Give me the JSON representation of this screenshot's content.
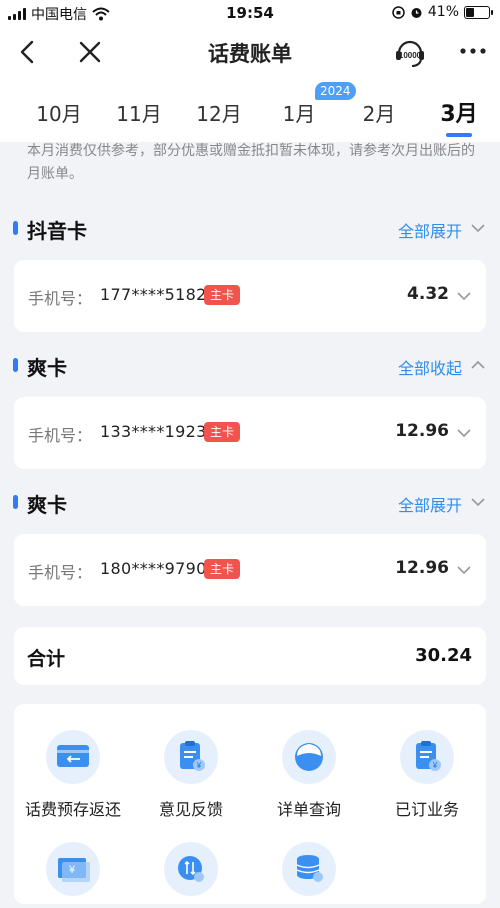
{
  "status": {
    "carrier": "中国电信",
    "time": "19:54",
    "battery": "41%",
    "battery_level": 0.41
  },
  "nav": {
    "title": "话费账单",
    "service_icon_text": "10000"
  },
  "months": {
    "year_badge": "2024",
    "items": [
      {
        "label": "10月",
        "active": false
      },
      {
        "label": "11月",
        "active": false
      },
      {
        "label": "12月",
        "active": false
      },
      {
        "label": "1月",
        "active": false
      },
      {
        "label": "2月",
        "active": false
      },
      {
        "label": "3月",
        "active": true
      }
    ]
  },
  "notice": "本月消费仅供参考，部分优惠或赠金抵扣暂未体现，请参考次月出账后的月账单。",
  "phone_label": "手机号：",
  "primary_tag": "主卡",
  "sections": [
    {
      "name": "抖音卡",
      "toggle": "全部展开",
      "phone": "177****5182",
      "amount": "4.32"
    },
    {
      "name": "爽卡",
      "toggle": "全部收起",
      "phone": "133****1923",
      "amount": "12.96"
    },
    {
      "name": "爽卡",
      "toggle": "全部展开",
      "phone": "180****9790",
      "amount": "12.96"
    }
  ],
  "total": {
    "label": "合计",
    "value": "30.24"
  },
  "services": [
    {
      "label": "话费预存返还",
      "icon": "card-return-icon"
    },
    {
      "label": "意见反馈",
      "icon": "feedback-icon"
    },
    {
      "label": "详单查询",
      "icon": "detail-query-icon"
    },
    {
      "label": "已订业务",
      "icon": "subscribed-icon"
    },
    {
      "label": "",
      "icon": "bill-icon"
    },
    {
      "label": "",
      "icon": "traffic-query-icon"
    },
    {
      "label": "",
      "icon": "data-query-icon"
    }
  ]
}
